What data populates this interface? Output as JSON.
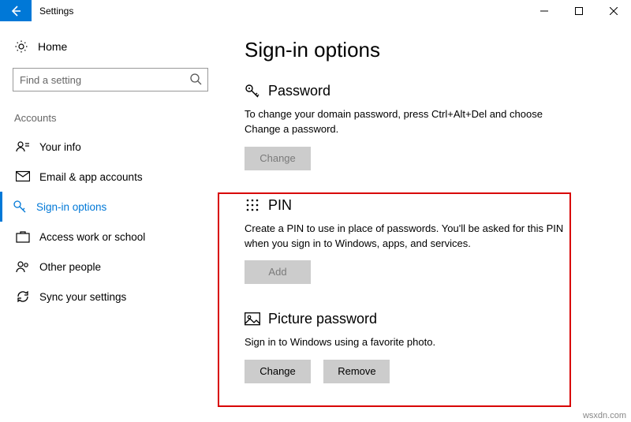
{
  "window": {
    "title": "Settings"
  },
  "sidebar": {
    "home_label": "Home",
    "search_placeholder": "Find a setting",
    "section_label": "Accounts",
    "items": [
      {
        "label": "Your info"
      },
      {
        "label": "Email & app accounts"
      },
      {
        "label": "Sign-in options"
      },
      {
        "label": "Access work or school"
      },
      {
        "label": "Other people"
      },
      {
        "label": "Sync your settings"
      }
    ]
  },
  "main": {
    "page_title": "Sign-in options",
    "password": {
      "heading": "Password",
      "desc": "To change your domain password, press Ctrl+Alt+Del and choose Change a password.",
      "change_label": "Change"
    },
    "pin": {
      "heading": "PIN",
      "desc": "Create a PIN to use in place of passwords. You'll be asked for this PIN when you sign in to Windows, apps, and services.",
      "add_label": "Add"
    },
    "picture": {
      "heading": "Picture password",
      "desc": "Sign in to Windows using a favorite photo.",
      "change_label": "Change",
      "remove_label": "Remove"
    }
  },
  "watermark": "wsxdn.com"
}
